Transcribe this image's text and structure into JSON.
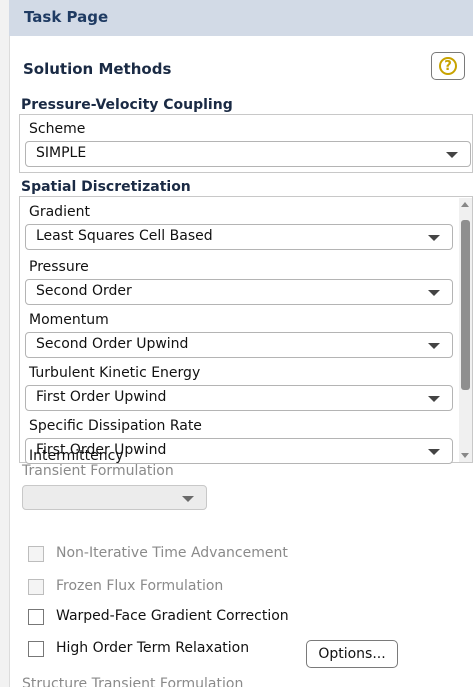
{
  "header": {
    "title": "Task Page"
  },
  "page": {
    "title": "Solution Methods",
    "help_icon": "question-mark-icon",
    "help_glyph": "?"
  },
  "pressure_velocity": {
    "title": "Pressure-Velocity Coupling",
    "scheme_label": "Scheme",
    "scheme_value": "SIMPLE"
  },
  "spatial": {
    "title": "Spatial Discretization",
    "fields": [
      {
        "label": "Gradient",
        "value": "Least Squares Cell Based"
      },
      {
        "label": "Pressure",
        "value": "Second Order"
      },
      {
        "label": "Momentum",
        "value": "Second Order Upwind"
      },
      {
        "label": "Turbulent Kinetic Energy",
        "value": "First Order Upwind"
      },
      {
        "label": "Specific Dissipation Rate",
        "value": "First Order Upwind"
      },
      {
        "label": "Intermittency"
      }
    ]
  },
  "transient": {
    "label": "Transient Formulation",
    "value": ""
  },
  "options": [
    {
      "label": "Non-Iterative Time Advancement",
      "checked": false,
      "enabled": false
    },
    {
      "label": "Frozen Flux Formulation",
      "checked": false,
      "enabled": false
    },
    {
      "label": "Warped-Face Gradient Correction",
      "checked": false,
      "enabled": true
    },
    {
      "label": "High Order Term Relaxation",
      "checked": false,
      "enabled": true
    }
  ],
  "options_button": {
    "label": "Options..."
  },
  "structure_transient": {
    "label": "Structure Transient Formulation"
  }
}
